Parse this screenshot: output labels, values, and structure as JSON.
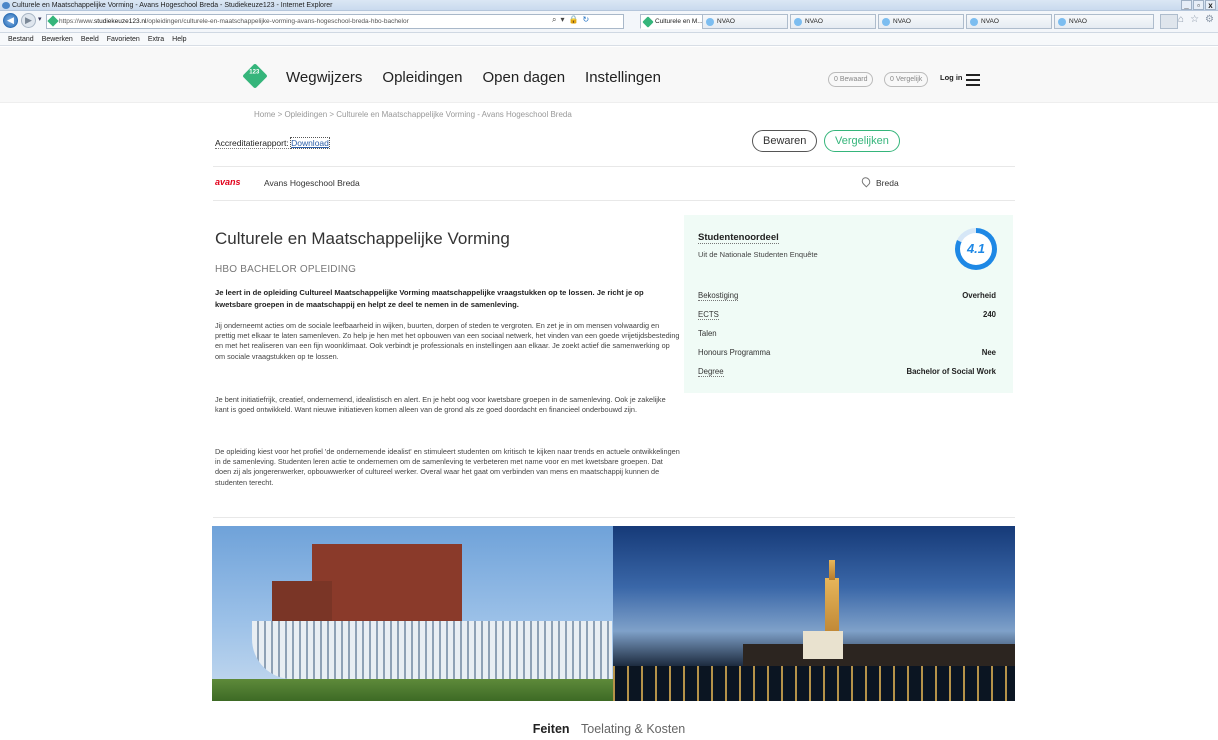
{
  "browser": {
    "window_title": "Culturele en Maatschappelijke Vorming - Avans Hogeschool Breda - Studiekeuze123 - Internet Explorer",
    "url_prefix": "https://www.",
    "url_domain": "studiekeuze123.nl",
    "url_path": "/opleidingen/culturele-en-maatschappelijke-vorming-avans-hogeschool-breda-hbo-bachelor",
    "search_glyph": "⌕",
    "tabs": [
      {
        "label": "Culturele en M...",
        "close": "×"
      },
      {
        "label": "NVAO"
      },
      {
        "label": "NVAO"
      },
      {
        "label": "NVAO"
      },
      {
        "label": "NVAO"
      },
      {
        "label": "NVAO"
      }
    ],
    "menu": [
      "Bestand",
      "Bewerken",
      "Beeld",
      "Favorieten",
      "Extra",
      "Help"
    ],
    "window_buttons": [
      "_",
      "▫",
      "x"
    ]
  },
  "site": {
    "nav": [
      "Wegwijzers",
      "Opleidingen",
      "Open dagen",
      "Instellingen"
    ],
    "bewaard_count": "0 Bewaard",
    "vergelijk_count": "0 Vergelijk",
    "login": "Log in"
  },
  "breadcrumb": "Home > Opleidingen > Culturele en Maatschappelijke Vorming - Avans Hogeschool Breda",
  "accreditation": {
    "label": "Accreditatierapport:",
    "link": "Download"
  },
  "actions": {
    "save": "Bewaren",
    "compare": "Vergelijken"
  },
  "institution": {
    "logo_text": "avans",
    "name": "Avans Hogeschool Breda",
    "city": "Breda"
  },
  "program": {
    "title": "Culturele en Maatschappelijke Vorming",
    "subtitle": "HBO BACHELOR OPLEIDING",
    "intro": "Je leert in de opleiding Cultureel Maatschappelijke Vorming maatschappelijke vraagstukken op te lossen. Je richt je op kwetsbare groepen in de maatschappij en helpt ze deel te nemen in de samenleving.",
    "paragraphs": [
      "Jij onderneemt acties om de sociale leefbaarheid in wijken, buurten, dorpen of steden te vergroten. En zet je in om mensen volwaardig en prettig met elkaar te laten samenleven. Zo help je hen met het opbouwen van een sociaal netwerk, het vinden van een goede vrijetijdsbesteding en met het realiseren van een fijn woonklimaat. Ook verbindt je professionals en instellingen aan elkaar. Je zoekt actief die samenwerking op om sociale vraagstukken op te lossen.",
      "Je bent initiatiefrijk, creatief, ondernemend, idealistisch en alert. En je hebt oog voor kwetsbare groepen in de samenleving. Ook je zakelijke kant is goed ontwikkeld. Want nieuwe initiatieven komen alleen van de grond als ze goed doordacht en financieel onderbouwd zijn.",
      "De opleiding kiest voor het profiel 'de ondernemende idealist' en stimuleert studenten om kritisch te kijken naar trends en actuele ontwikkelingen in de samenleving. Studenten leren actie te ondernemen om de samenleving te verbeteren met name voor en met kwetsbare groepen. Dat doen zij als jongerenwerker, opbouwwerker of cultureel werker. Overal waar het gaat om verbinden van mens en maatschappij kunnen de studenten terecht."
    ]
  },
  "factbox": {
    "title": "Studentenoordeel",
    "subtitle": "Uit de Nationale Studenten Enquête",
    "score": "4.1",
    "score_fraction": 0.82,
    "rows": [
      {
        "key": "Bekostiging",
        "value": "Overheid"
      },
      {
        "key": "ECTS",
        "value": "240"
      },
      {
        "key": "Talen",
        "value": ""
      },
      {
        "key": "Honours Programma",
        "value": "Nee"
      },
      {
        "key": "Degree",
        "value": "Bachelor of Social Work"
      }
    ]
  },
  "content_tabs": [
    "Feiten",
    "Toelating & Kosten"
  ],
  "colors": {
    "brand_green": "#35b57b",
    "score_blue": "#1e88e5",
    "avans_red": "#e2001a",
    "factbox_bg": "#f0fbf6"
  }
}
